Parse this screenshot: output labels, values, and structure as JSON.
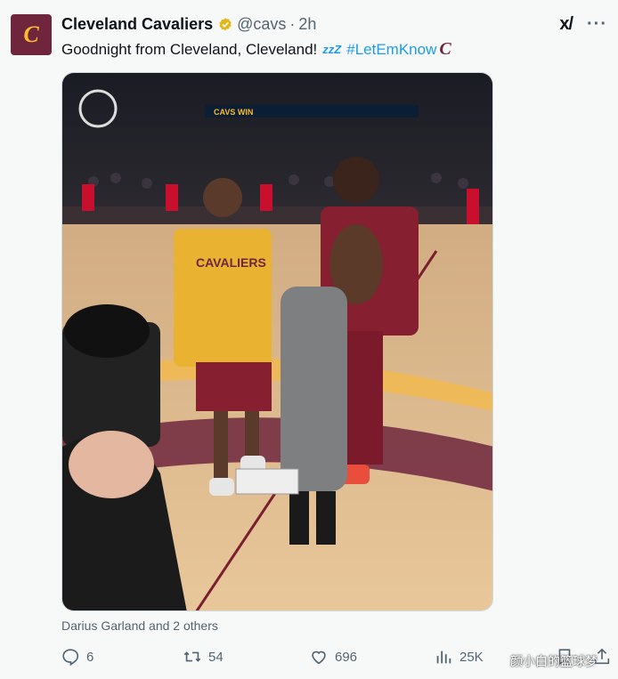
{
  "account": {
    "avatar_letter": "C",
    "name": "Cleveland Cavaliers",
    "handle": "@cavs",
    "separator": "·",
    "time": "2h",
    "brand_color": "#6f263d",
    "accent_color": "#fdbb30"
  },
  "top_icons": {
    "grok": "x/",
    "more": "···"
  },
  "post": {
    "text": "Goodnight from Cleveland, Cleveland!",
    "emoji_text": "zzZ",
    "hashtag": "#LetEmKnow",
    "hashflag": "C",
    "link_color": "#1d9bf0"
  },
  "media": {
    "arena_banner": "CAVS WIN",
    "jersey_text": "CAVALIERS"
  },
  "tagged": "Darius Garland and 2 others",
  "actions": {
    "replies": "6",
    "retweets": "54",
    "likes": "696",
    "views": "25K"
  },
  "watermark": "颜小白的篮球梦"
}
